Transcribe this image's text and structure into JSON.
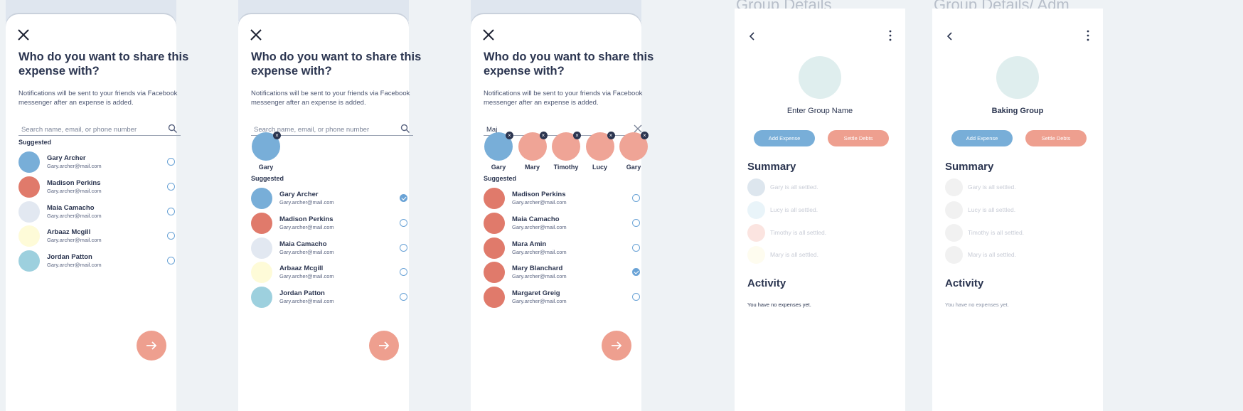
{
  "screens": [
    {
      "title": "Who do you want to share this expense with?",
      "description": "Notifications will be sent to your friends via Facebook messenger after an expense is added.",
      "search_placeholder": "Search name, email, or phone number",
      "search_value": "",
      "suggested_label": "Suggested",
      "rows": [
        {
          "name": "Gary Archer",
          "email": "Gary.archer@mail.com",
          "color": "#78aed8",
          "checked": false
        },
        {
          "name": "Madison Perkins",
          "email": "Gary.archer@mail.com",
          "color": "#e07a6b",
          "checked": false
        },
        {
          "name": "Maia Camacho",
          "email": "Gary.archer@mail.com",
          "color": "#e2e8f1",
          "checked": false
        },
        {
          "name": "Arbaaz Mcgill",
          "email": "Gary.archer@mail.com",
          "color": "#fefbd8",
          "checked": false
        },
        {
          "name": "Jordan Patton",
          "email": "Gary.archer@mail.com",
          "color": "#9dd0de",
          "checked": false
        }
      ]
    },
    {
      "title": "Who do you want to share this expense with?",
      "description": "Notifications will be sent to your friends via Facebook messenger after an expense is added.",
      "search_placeholder": "Search name, email, or phone number",
      "search_value": "",
      "suggested_label": "Suggested",
      "chips": [
        {
          "label": "Gary",
          "color": "#78aed8"
        }
      ],
      "rows": [
        {
          "name": "Gary Archer",
          "email": "Gary.archer@mail.com",
          "color": "#78aed8",
          "checked": true
        },
        {
          "name": "Madison Perkins",
          "email": "Gary.archer@mail.com",
          "color": "#e07a6b",
          "checked": false
        },
        {
          "name": "Maia Camacho",
          "email": "Gary.archer@mail.com",
          "color": "#e2e8f1",
          "checked": false
        },
        {
          "name": "Arbaaz Mcgill",
          "email": "Gary.archer@mail.com",
          "color": "#fefbd8",
          "checked": false
        },
        {
          "name": "Jordan Patton",
          "email": "Gary.archer@mail.com",
          "color": "#9dd0de",
          "checked": false
        }
      ]
    },
    {
      "title": "Who do you want to share this expense with?",
      "description": "Notifications will be sent to your friends via Facebook messenger after an expense is added.",
      "search_placeholder": "",
      "search_value": "Maj",
      "suggested_label": "Suggested",
      "chips": [
        {
          "label": "Gary",
          "color": "#78aed8"
        },
        {
          "label": "Mary",
          "color": "#efa496"
        },
        {
          "label": "Timothy",
          "color": "#efa496"
        },
        {
          "label": "Lucy",
          "color": "#efa496"
        },
        {
          "label": "Gary",
          "color": "#efa496"
        }
      ],
      "rows": [
        {
          "name": "Madison Perkins",
          "email": "Gary.archer@mail.com",
          "color": "#e07a6b",
          "checked": false
        },
        {
          "name": "Maia Camacho",
          "email": "Gary.archer@mail.com",
          "color": "#e07a6b",
          "checked": false
        },
        {
          "name": "Mara Amin",
          "email": "Gary.archer@mail.com",
          "color": "#e07a6b",
          "checked": false
        },
        {
          "name": "Mary Blanchard",
          "email": "Gary.archer@mail.com",
          "color": "#e07a6b",
          "checked": true
        },
        {
          "name": "Margaret Greig",
          "email": "Gary.archer@mail.com",
          "color": "#e07a6b",
          "checked": false
        }
      ]
    }
  ],
  "group_screens": [
    {
      "frame_title": "Group Details",
      "group_name": "Enter Group Name",
      "add_expense": "Add Expense",
      "settle_debts": "Settle Debts",
      "summary_heading": "Summary",
      "summary": [
        {
          "text": "Gary is all settled.",
          "color": "#dde6ee"
        },
        {
          "text": "Lucy is all settled.",
          "color": "#e9f4f9"
        },
        {
          "text": "Timothy is all settled.",
          "color": "#fbe4e0"
        },
        {
          "text": "Mary is all settled.",
          "color": "#fefcef"
        }
      ],
      "activity_heading": "Activity",
      "no_expenses": "You have no expenses yet."
    },
    {
      "frame_title": "Group Details/ Adm",
      "group_name": "Baking Group",
      "add_expense": "Add Expense",
      "settle_debts": "Settle Debts",
      "summary_heading": "Summary",
      "summary": [
        {
          "text": "Gary is all settled.",
          "color": "#f1f1f1"
        },
        {
          "text": "Lucy is all settled.",
          "color": "#f1f1f1"
        },
        {
          "text": "Timothy is all settled.",
          "color": "#f1f1f1"
        },
        {
          "text": "Mary is all settled.",
          "color": "#f1f1f1"
        }
      ],
      "activity_heading": "Activity",
      "no_expenses": "You have no expenses yet."
    }
  ],
  "colors": {
    "primary_blue": "#78aed8",
    "salmon": "#ee9f8f",
    "text": "#2b3550"
  }
}
